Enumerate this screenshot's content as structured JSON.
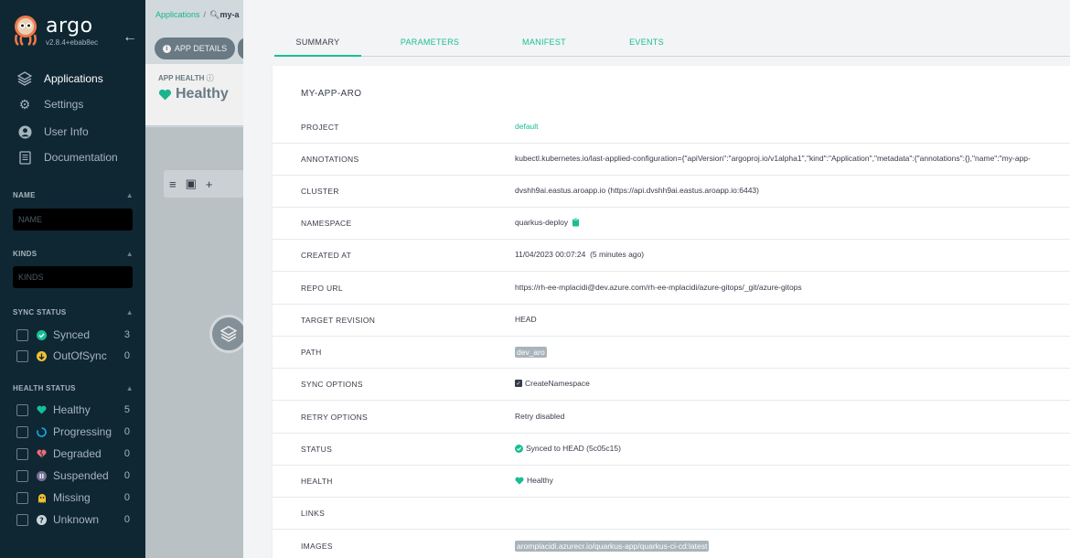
{
  "sidebar": {
    "brand": {
      "name": "argo",
      "version": "v2.8.4+ebab8ec"
    },
    "nav": [
      {
        "label": "Applications",
        "icon": "layers-icon",
        "active": true
      },
      {
        "label": "Settings",
        "icon": "gears-icon",
        "active": false
      },
      {
        "label": "User Info",
        "icon": "user-circle-icon",
        "active": false
      },
      {
        "label": "Documentation",
        "icon": "book-icon",
        "active": false
      }
    ],
    "filters": {
      "name": {
        "title": "NAME",
        "placeholder": "NAME"
      },
      "kinds": {
        "title": "KINDS",
        "placeholder": "KINDS"
      },
      "sync_status": {
        "title": "SYNC STATUS",
        "items": [
          {
            "label": "Synced",
            "count": "3",
            "color": "#18be94"
          },
          {
            "label": "OutOfSync",
            "count": "0",
            "color": "#f4c030"
          }
        ]
      },
      "health_status": {
        "title": "HEALTH STATUS",
        "items": [
          {
            "label": "Healthy",
            "count": "5",
            "color": "#18be94"
          },
          {
            "label": "Progressing",
            "count": "0",
            "color": "#0dadea"
          },
          {
            "label": "Degraded",
            "count": "0",
            "color": "#e96d76"
          },
          {
            "label": "Suspended",
            "count": "0",
            "color": "#766f94"
          },
          {
            "label": "Missing",
            "count": "0",
            "color": "#f4c030"
          },
          {
            "label": "Unknown",
            "count": "0",
            "color": "#ccd6dd"
          }
        ]
      }
    }
  },
  "main": {
    "breadcrumb": {
      "root": "Applications",
      "current": "my-a"
    },
    "app_details_label": "APP DETAILS",
    "app_health": {
      "label": "APP HEALTH",
      "value": "Healthy"
    }
  },
  "panel": {
    "tabs": [
      {
        "label": "SUMMARY",
        "active": true
      },
      {
        "label": "PARAMETERS",
        "active": false
      },
      {
        "label": "MANIFEST",
        "active": false
      },
      {
        "label": "EVENTS",
        "active": false
      }
    ],
    "title": "MY-APP-ARO",
    "rows": {
      "project": {
        "key": "PROJECT",
        "value": "default"
      },
      "annotations": {
        "key": "ANNOTATIONS",
        "value": "kubectl.kubernetes.io/last-applied-configuration={\"apiVersion\":\"argoproj.io/v1alpha1\",\"kind\":\"Application\",\"metadata\":{\"annotations\":{},\"name\":\"my-app-"
      },
      "cluster": {
        "key": "CLUSTER",
        "value": "dvshh9ai.eastus.aroapp.io (https://api.dvshh9ai.eastus.aroapp.io:6443)"
      },
      "namespace": {
        "key": "NAMESPACE",
        "value": "quarkus-deploy"
      },
      "created_at": {
        "key": "CREATED AT",
        "value": "11/04/2023 00:07:24  (5 minutes ago)"
      },
      "repo_url": {
        "key": "REPO URL",
        "value": "https://rh-ee-mplacidi@dev.azure.com/rh-ee-mplacidi/azure-gitops/_git/azure-gitops"
      },
      "target_revision": {
        "key": "TARGET REVISION",
        "value": "HEAD"
      },
      "path": {
        "key": "PATH",
        "value": "dev_aro"
      },
      "sync_options": {
        "key": "SYNC OPTIONS",
        "value": "CreateNamespace"
      },
      "retry_options": {
        "key": "RETRY OPTIONS",
        "value": "Retry disabled"
      },
      "status": {
        "key": "STATUS",
        "value": "Synced to HEAD (5c05c15)"
      },
      "health": {
        "key": "HEALTH",
        "value": "Healthy"
      },
      "links": {
        "key": "LINKS",
        "value": ""
      },
      "images": {
        "key": "IMAGES",
        "value": "aromplacidi.azurecr.io/quarkus-app/quarkus-ci-cd:latest"
      }
    }
  }
}
